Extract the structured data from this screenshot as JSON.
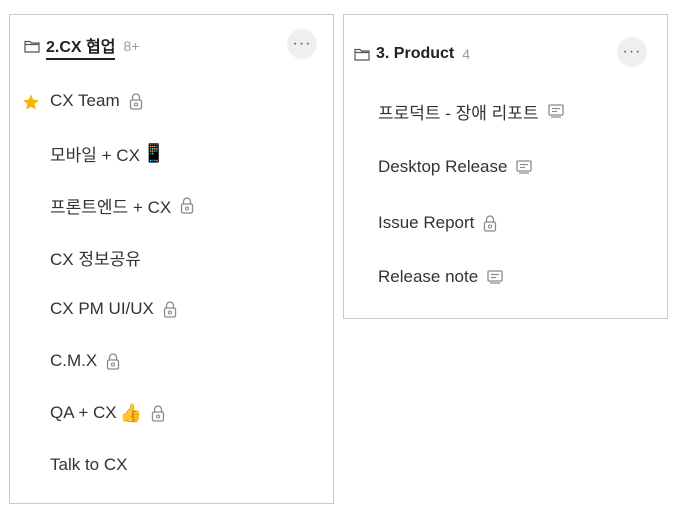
{
  "cx_card": {
    "title": "2.CX 협업",
    "count": "8+",
    "more_label": "···",
    "items": [
      {
        "label": "CX Team",
        "icon": "lock-icon",
        "starred": true
      },
      {
        "label": "모바일 + CX",
        "emoji": "📱"
      },
      {
        "label": "프론트엔드 + CX",
        "icon": "lock-icon"
      },
      {
        "label": "CX 정보공유"
      },
      {
        "label": "CX PM UI/UX",
        "icon": "lock-icon"
      },
      {
        "label": "C.M.X",
        "icon": "lock-icon"
      },
      {
        "label": "QA + CX",
        "emoji": "👍",
        "icon": "lock-icon"
      },
      {
        "label": "Talk to CX"
      }
    ]
  },
  "product_card": {
    "title": "3. Product",
    "count": "4",
    "more_label": "···",
    "items": [
      {
        "label": "프로덕트 - 장애 리포트",
        "icon": "page-icon"
      },
      {
        "label": "Desktop Release",
        "icon": "page-icon"
      },
      {
        "label": "Issue Report",
        "icon": "lock-icon"
      },
      {
        "label": "Release note",
        "icon": "page-icon"
      }
    ]
  },
  "colors": {
    "star": "#f5b400",
    "icon_gray": "#8a8a8a"
  }
}
